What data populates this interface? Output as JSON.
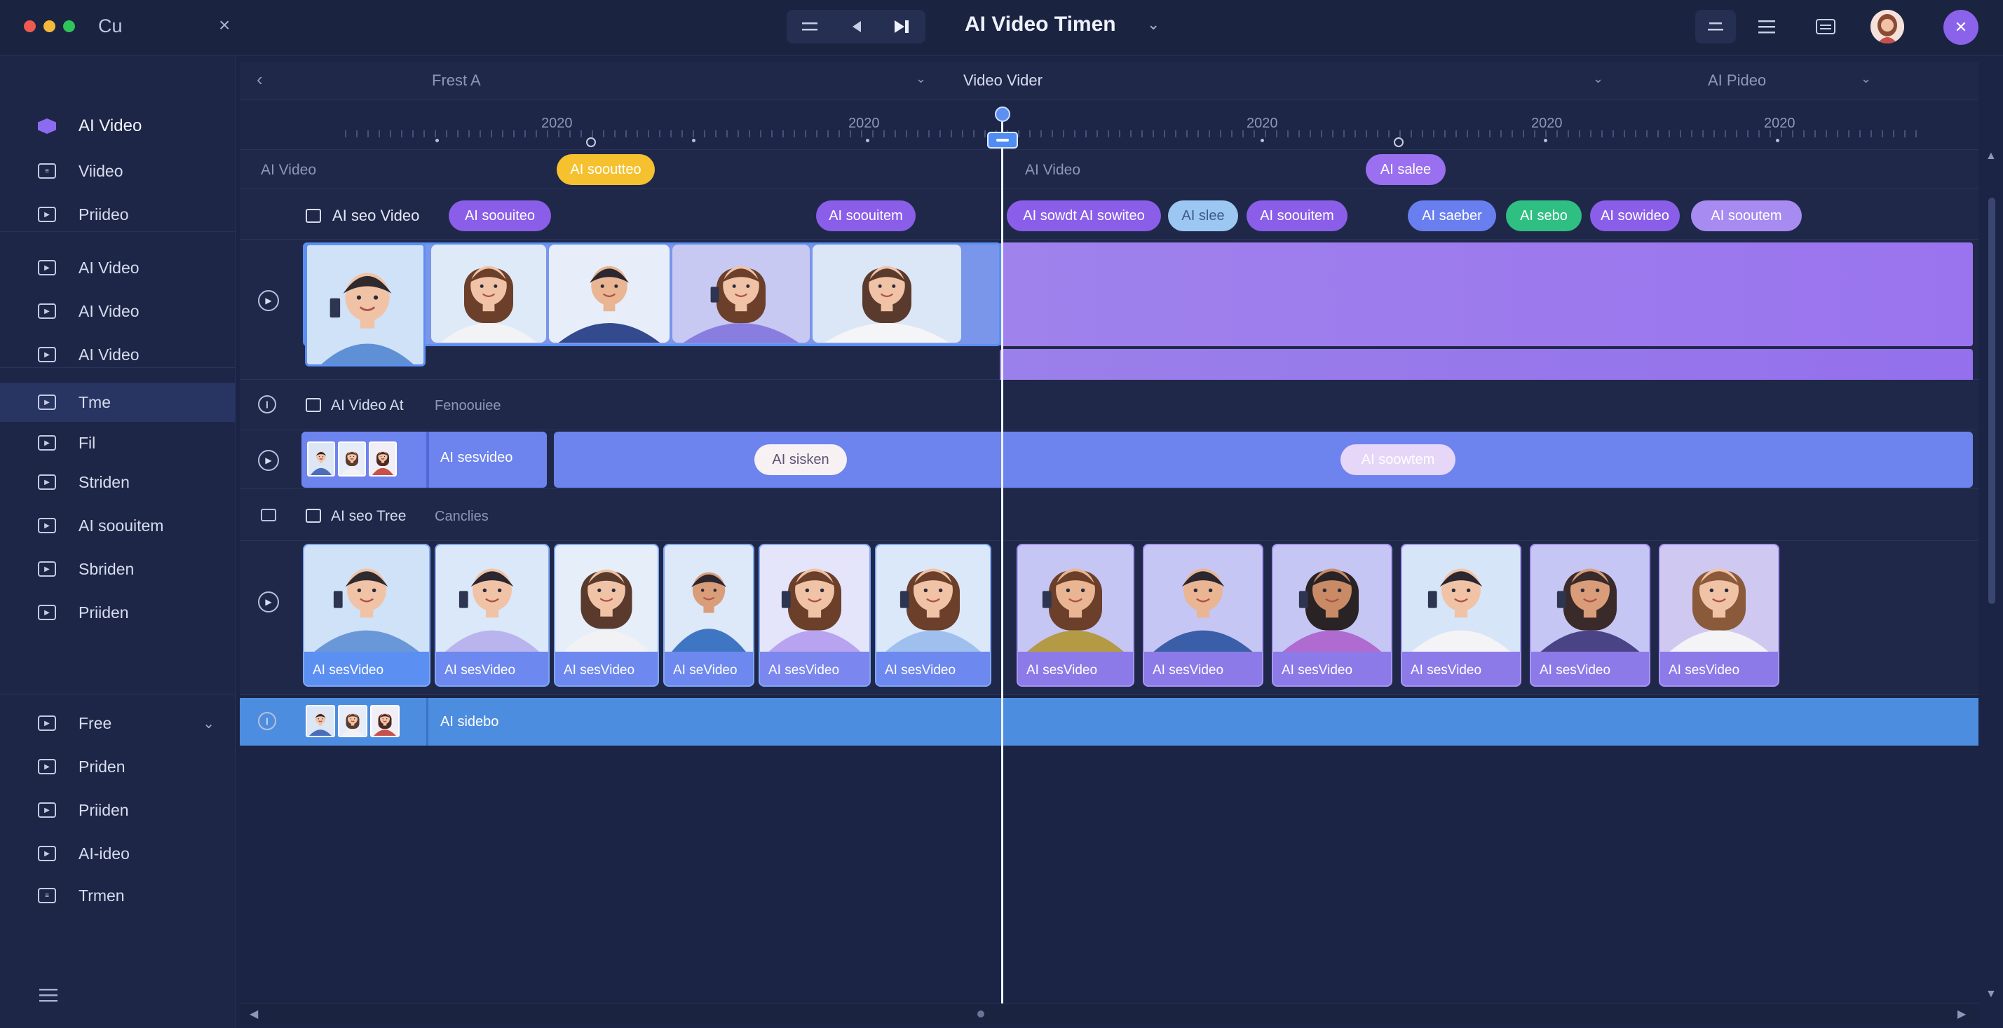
{
  "window": {
    "app_name": "Cu",
    "close_symbol": "×",
    "title": "AI Video Timen",
    "title_chevron": "⌄"
  },
  "transport": {
    "icons": [
      "menu-icon",
      "rewind-icon",
      "skip-forward-icon"
    ]
  },
  "toolbar": {
    "icons": [
      "sort-icon",
      "list-icon",
      "subtitles-icon",
      "avatar",
      "close-icon"
    ]
  },
  "sidebar": {
    "items": [
      {
        "label": "AI Video",
        "icon": "ai-hexagon-icon"
      },
      {
        "label": "Viideo",
        "icon": "captions-icon"
      },
      {
        "label": "Priideo",
        "icon": "play-icon"
      },
      {
        "label": "AI Video",
        "icon": "play-icon"
      },
      {
        "label": "AI Video",
        "icon": "play-icon"
      },
      {
        "label": "AI Video",
        "icon": "play-icon"
      },
      {
        "label": "Tme",
        "icon": "play-icon"
      },
      {
        "label": "Fil",
        "icon": "play-icon"
      },
      {
        "label": "Striden",
        "icon": "play-icon"
      },
      {
        "label": "AI soouitem",
        "icon": "play-icon"
      },
      {
        "label": "Sbriden",
        "icon": "play-icon"
      },
      {
        "label": "Priiden",
        "icon": "play-icon"
      },
      {
        "label": "Free",
        "icon": "play-icon"
      },
      {
        "label": "Priden",
        "icon": "play-icon"
      },
      {
        "label": "Priiden",
        "icon": "play-icon"
      },
      {
        "label": "AI-ideo",
        "icon": "play-icon"
      },
      {
        "label": "Trmen",
        "icon": "captions-icon"
      }
    ],
    "free_chevron": "⌄"
  },
  "header_strip": {
    "back": "‹",
    "left_label": "Frest  A",
    "center_label": "Video Vider",
    "right_label": "AI Pideo",
    "chevron": "⌄"
  },
  "ruler": {
    "years": [
      "2020",
      "2020",
      "2020",
      "2020",
      "2020"
    ]
  },
  "track_ai_video": {
    "label_left": "AI Video",
    "label_right": "AI Video",
    "pill_yellow": "AI sooutteo",
    "pill_purple": "AI salee"
  },
  "track_seo": {
    "label": "AI seo Video",
    "pills": [
      "AI soouiteo",
      "AI soouitem",
      "AI sowdt   AI sowiteo",
      "AI slee",
      "AI soouitem",
      "AI saeber",
      "AI sebo",
      "AI sowideo",
      "AI sooutem"
    ]
  },
  "track_video_at": {
    "label": "AI Video At",
    "sub_label": "Fenoouiee"
  },
  "track_sesvideo": {
    "clip_label": "AI sesvideo",
    "pill_a": "AI sisken",
    "pill_b": "AI soowtem"
  },
  "track_seo_tree": {
    "label": "AI seo Tree",
    "sub_label": "Canclies"
  },
  "tiles": [
    {
      "caption": "AI sesVideo"
    },
    {
      "caption": "AI sesVideo"
    },
    {
      "caption": "AI sesVideo"
    },
    {
      "caption": "AI seVideo"
    },
    {
      "caption": "AI sesVideo"
    },
    {
      "caption": "AI sesVideo"
    },
    {
      "caption": "AI sesVideo"
    },
    {
      "caption": "AI sesVideo"
    },
    {
      "caption": "AI sesVideo"
    },
    {
      "caption": "AI sesVideo"
    },
    {
      "caption": "AI sesVideo"
    },
    {
      "caption": "AI sesVideo"
    }
  ],
  "track_sidebo": {
    "clip_label": "AI sidebo"
  },
  "colors": {
    "background": "#1b2444",
    "accent_purple": "#9a6ff0",
    "accent_blue": "#5b8ff2",
    "playhead": "#eef2ff"
  }
}
